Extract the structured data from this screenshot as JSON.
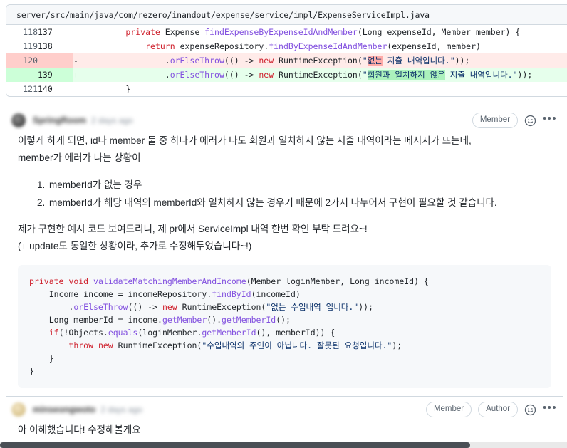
{
  "diff": {
    "file_path": "server/src/main/java/com/rezero/inandout/expense/service/impl/ExpenseServiceImpl.java",
    "rows": [
      {
        "type": "ctx",
        "old": "118",
        "new": "137",
        "marker": ""
      },
      {
        "type": "ctx",
        "old": "119",
        "new": "138",
        "marker": ""
      },
      {
        "type": "del",
        "old": "120",
        "new": "",
        "marker": "-"
      },
      {
        "type": "add",
        "old": "",
        "new": "139",
        "marker": "+"
      },
      {
        "type": "ctx",
        "old": "121",
        "new": "140",
        "marker": ""
      }
    ],
    "line1_text": "        private Expense findExpenseByExpenseIdAndMember(Long expenseId, Member member) {",
    "line2_text": "            return expenseRepository.findByExpenseIdAndMember(expenseId, member)",
    "line3_text": "                .orElseThrow(() -> new RuntimeException(\"없는 지출 내역입니다.\"));",
    "line4_text": "                .orElseThrow(() -> new RuntimeException(\"회원과 일치하지 않은 지출 내역입니다.\"));",
    "line5_text": "        }",
    "deleted_word": "없는",
    "added_word": "회원과 일치하지 않은"
  },
  "comments": [
    {
      "author": "SpringRoom",
      "timestamp": "2 days ago",
      "badges": [
        "Member"
      ],
      "paragraph1_line1": "이렇게 하게 되면, id나 member 둘 중 하나가 에러가 나도 회원과 일치하지 않는 지출 내역이라는 메시지가 뜨는데,",
      "paragraph1_line2": "member가 에러가 나는 상황이",
      "list": [
        "memberId가 없는 경우",
        "memberId가 해당 내역의 memberId와 일치하지 않는 경우기 때문에 2가지 나누어서 구현이 필요할 것 같습니다."
      ],
      "paragraph2_line1": "제가 구현한 예시 코드 보여드리니, 제 pr에서 ServiceImpl 내역 한번 확인 부탁 드려요~!",
      "paragraph2_line2": "(+ update도 동일한 상황이라, 추가로 수정해두었습니다~!)",
      "code_lines": [
        "private void validateMatchingMemberAndIncome(Member loginMember, Long incomeId) {",
        "    Income income = incomeRepository.findById(incomeId)",
        "        .orElseThrow(() -> new RuntimeException(\"없는 수입내역 입니다.\"));",
        "    Long memberId = income.getMember().getMemberId();",
        "    if(!Objects.equals(loginMember.getMemberId(), memberId)) {",
        "        throw new RuntimeException(\"수입내역의 주인이 아닙니다. 잘못된 요청입니다.\");",
        "    }",
        "}"
      ]
    },
    {
      "author": "minseongwoto",
      "timestamp": "2 days ago",
      "badges": [
        "Member",
        "Author"
      ],
      "text": "아 이해했습니다! 수정해볼게요"
    }
  ],
  "icons": {
    "reaction": "smiley-face-icon",
    "more": "kebab-menu-icon"
  },
  "colors": {
    "diff_add_bg": "#e6ffec",
    "diff_del_bg": "#ffebe9",
    "diff_add_word": "#abf2bc",
    "diff_del_word": "#ffaba8",
    "border": "#d1d9e0",
    "code_bg": "#f6f8fa"
  }
}
